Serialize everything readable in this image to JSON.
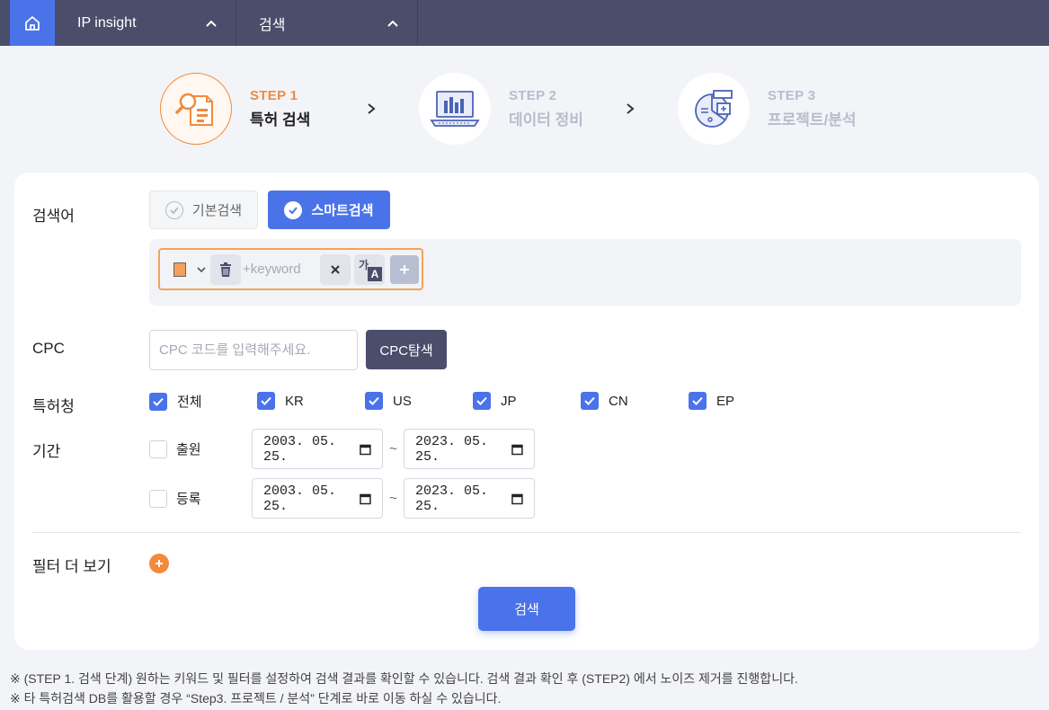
{
  "nav": {
    "menu1": "IP insight",
    "menu2": "검색"
  },
  "steps": [
    {
      "num": "STEP 1",
      "title": "특허 검색",
      "active": true
    },
    {
      "num": "STEP 2",
      "title": "데이터 정비",
      "active": false
    },
    {
      "num": "STEP 3",
      "title": "프로젝트/분석",
      "active": false
    }
  ],
  "form": {
    "keyword_label": "검색어",
    "mode_basic": "기본검색",
    "mode_smart": "스마트검색",
    "keyword_placeholder": "+keyword",
    "keyword_color": "#f2a05a",
    "translate_glyph_top": "가",
    "translate_glyph_bottom": "A",
    "cpc_label": "CPC",
    "cpc_placeholder": "CPC 코드를 입력해주세요.",
    "cpc_button": "CPC탐색",
    "office_label": "특허청",
    "offices": [
      {
        "label": "전체",
        "checked": true
      },
      {
        "label": "KR",
        "checked": true
      },
      {
        "label": "US",
        "checked": true
      },
      {
        "label": "JP",
        "checked": true
      },
      {
        "label": "CN",
        "checked": true
      },
      {
        "label": "EP",
        "checked": true
      }
    ],
    "period_label": "기간",
    "periods": [
      {
        "label": "출원",
        "checked": false,
        "from": "2003. 05. 25.",
        "to": "2023. 05. 25."
      },
      {
        "label": "등록",
        "checked": false,
        "from": "2003. 05. 25.",
        "to": "2023. 05. 25."
      }
    ],
    "tilde": "~",
    "more_filters_label": "필터 더 보기",
    "search_button": "검색"
  },
  "notes": [
    "※ (STEP 1. 검색 단계) 원하는 키워드 및 필터를 설정하여 검색 결과를 확인할 수 있습니다. 검색 결과 확인 후 (STEP2) 에서 노이즈 제거를 진행합니다.",
    "※ 타 특허검색 DB를 활용할 경우 “Step3. 프로젝트 / 분석” 단계로 바로 이동 하실 수 있습니다."
  ],
  "colors": {
    "accent": "#4a73ea",
    "orange": "#f28a3c",
    "nav_bg": "#4a4e6b"
  }
}
